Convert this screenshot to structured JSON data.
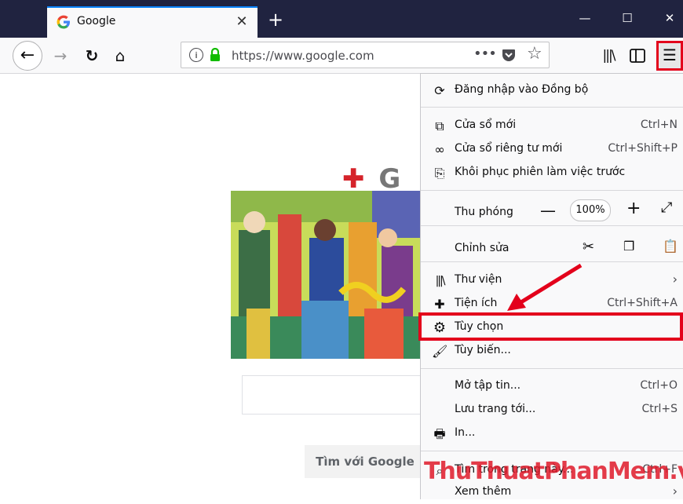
{
  "browser": {
    "tab_title": "Google",
    "url": "https://www.google.com",
    "new_tab": "+",
    "window_controls": {
      "minimize": "—",
      "maximize": "☐",
      "close": "✕"
    }
  },
  "icons": {
    "back": "arrow-left-icon",
    "forward": "arrow-right-icon",
    "reload": "reload-icon",
    "home": "home-icon",
    "info": "info-icon",
    "lock": "lock-icon",
    "page_actions": "more-icon",
    "pocket": "pocket-icon",
    "bookmark": "star-icon",
    "library": "library-icon",
    "sidebar": "sidebar-icon",
    "menu": "hamburger-icon"
  },
  "page": {
    "search_button": "Tìm với Google"
  },
  "menu": {
    "sync": "Đăng nhập vào Đồng bộ",
    "new_window": "Cửa sổ mới",
    "new_window_sc": "Ctrl+N",
    "private_window": "Cửa sổ riêng tư mới",
    "private_window_sc": "Ctrl+Shift+P",
    "restore_session": "Khôi phục phiên làm việc trước",
    "zoom_label": "Thu phóng",
    "zoom_value": "100%",
    "edit_label": "Chỉnh sửa",
    "library": "Thư viện",
    "addons": "Tiện ích",
    "addons_sc": "Ctrl+Shift+A",
    "options": "Tùy chọn",
    "customize": "Tùy biến...",
    "open_file": "Mở tập tin...",
    "open_file_sc": "Ctrl+O",
    "save_page": "Lưu trang tới...",
    "save_page_sc": "Ctrl+S",
    "print": "In...",
    "find": "Tìm trong trang này...",
    "find_sc": "Ctrl+F",
    "more": "Xem thêm"
  },
  "watermark": "ThuThuatPhanMem.vn",
  "colors": {
    "highlight": "#e3001b",
    "titlebar": "#202340",
    "accent": "#0a84ff",
    "lock": "#12bc00"
  }
}
